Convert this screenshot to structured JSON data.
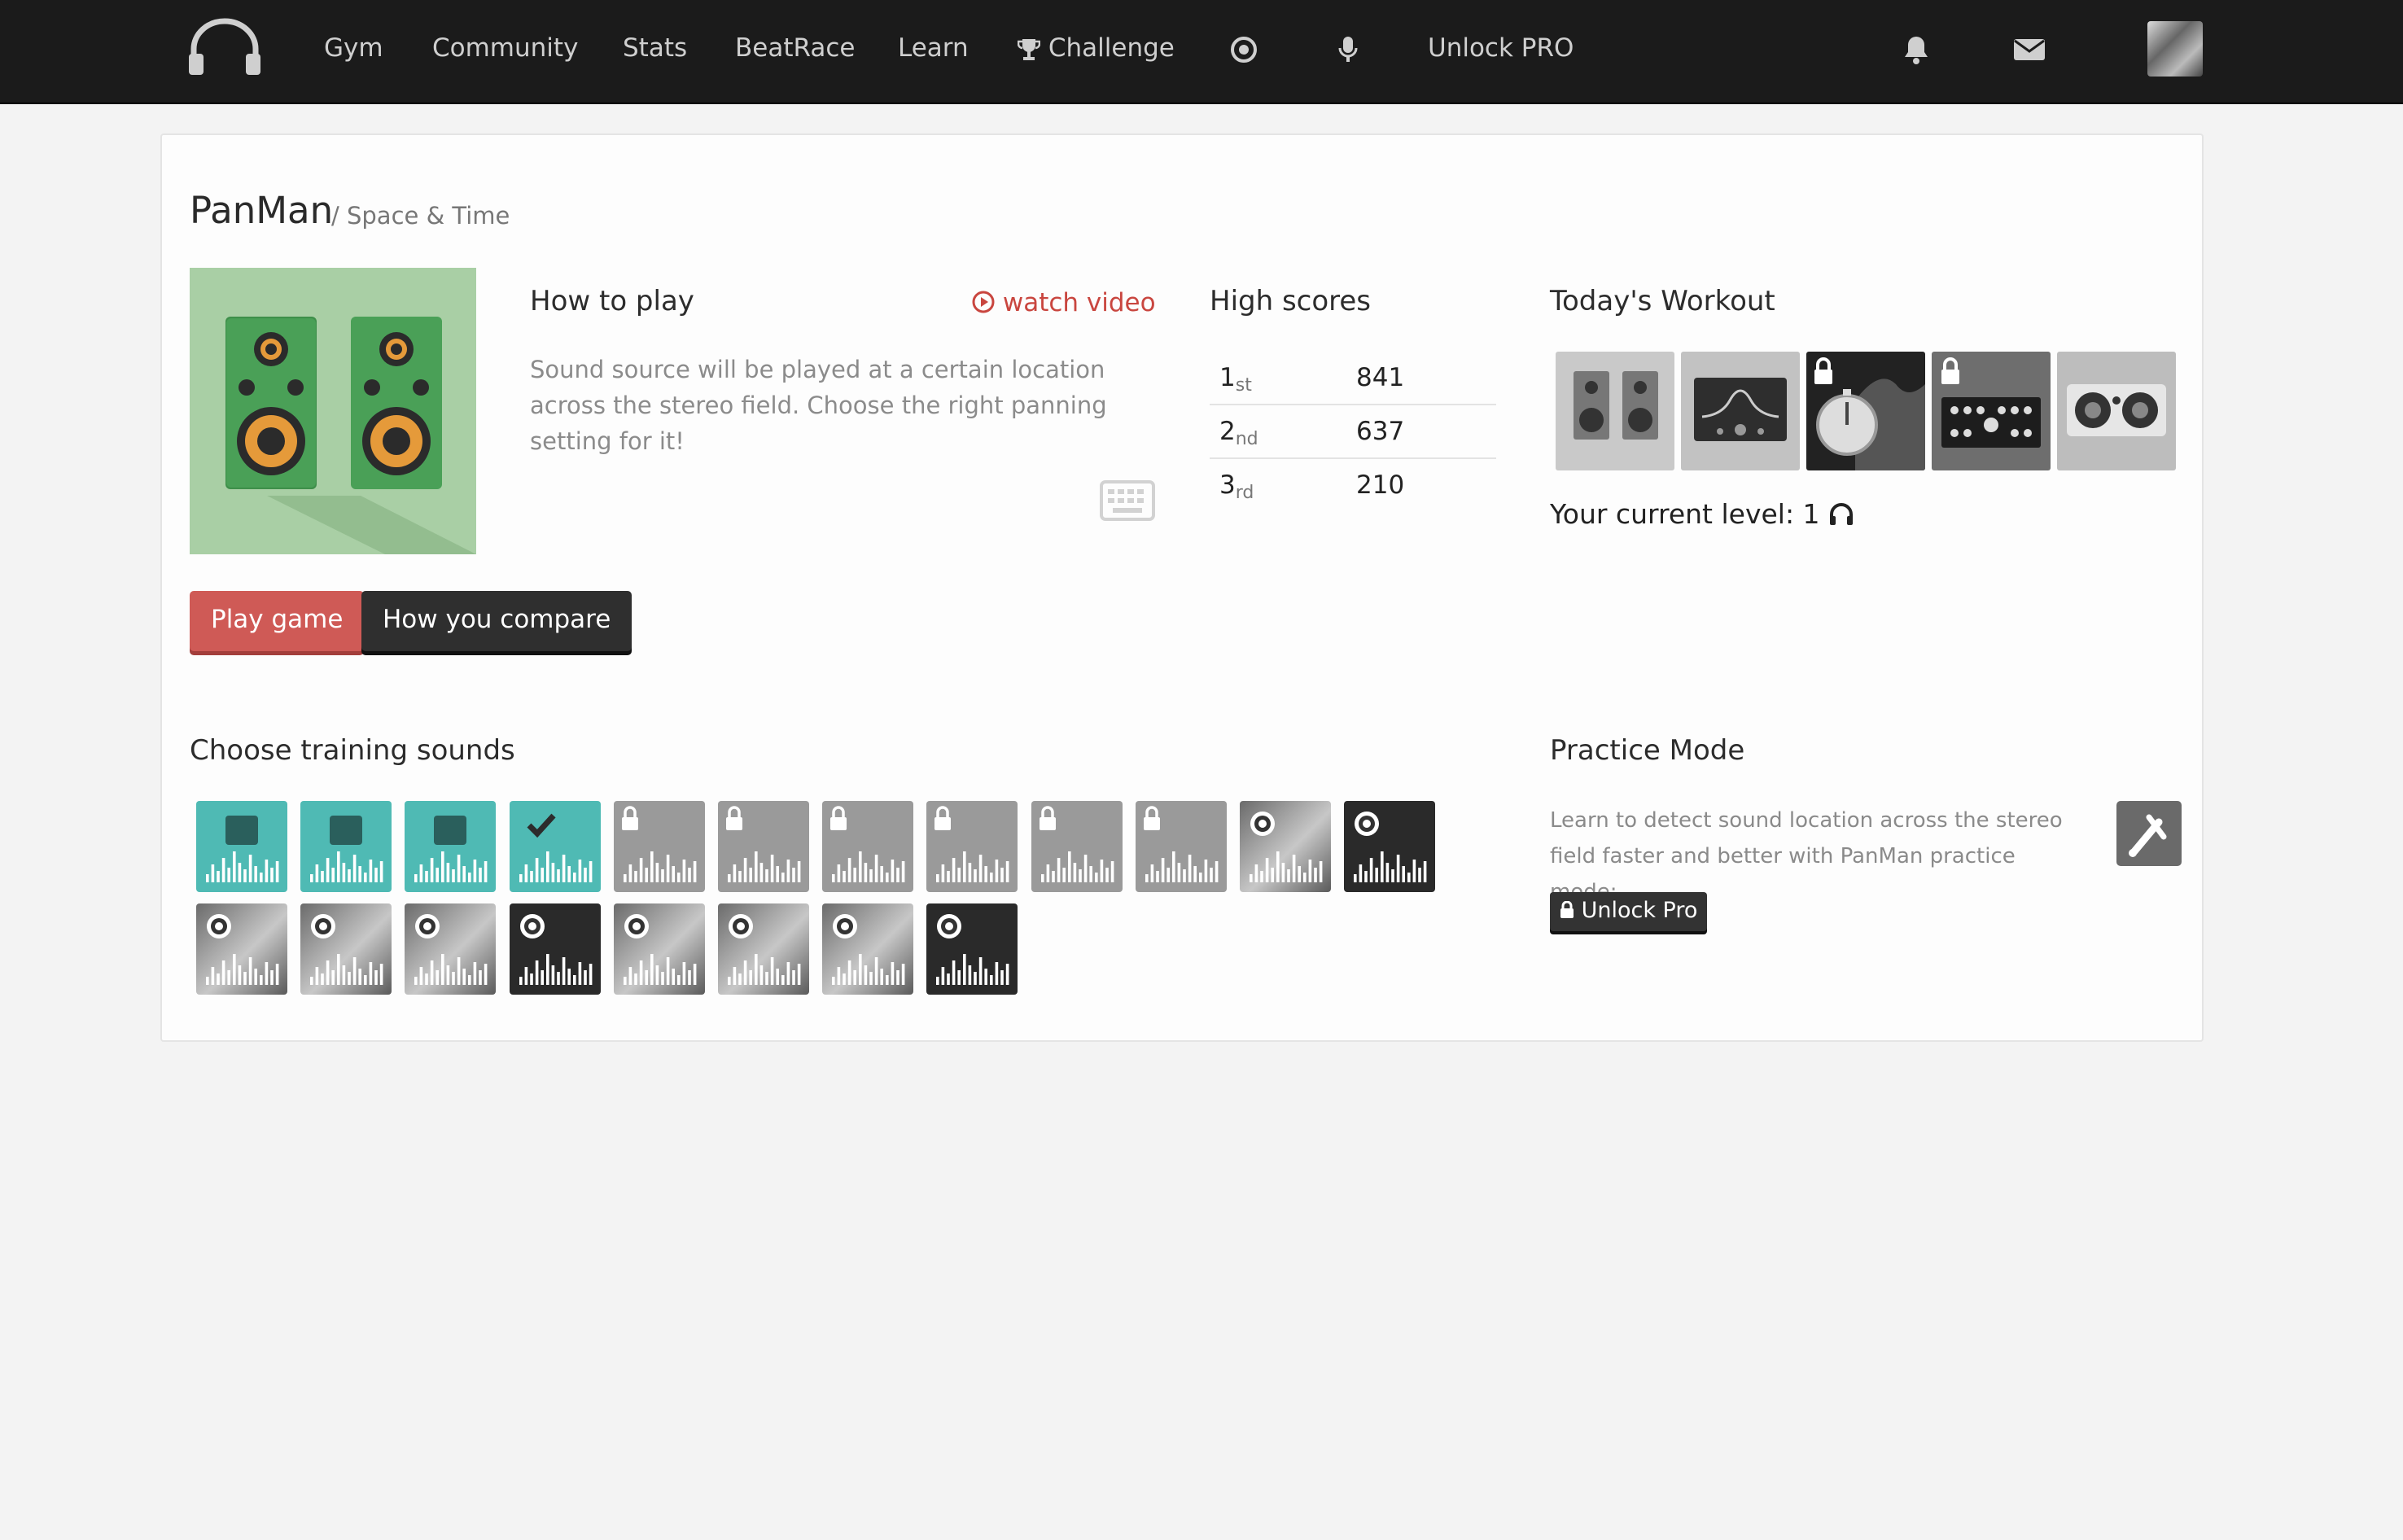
{
  "nav": {
    "items": [
      "Gym",
      "Community",
      "Stats",
      "BeatRace",
      "Learn",
      "Challenge",
      "Unlock PRO"
    ],
    "icons": [
      "headphones-logo-icon",
      "trophy-icon",
      "target-icon",
      "microphone-icon",
      "bell-icon",
      "envelope-icon",
      "avatar"
    ]
  },
  "game": {
    "title": "PanMan",
    "subtitle": "/ Space & Time",
    "how_to_play": "How to play",
    "watch_video": "watch video",
    "description": "Sound source will be played at a certain location across the stereo field. Choose the right panning setting for it!",
    "play_button": "Play game",
    "compare_button": "How you compare"
  },
  "high_scores": {
    "title": "High scores",
    "rows": [
      {
        "rank": "1",
        "suffix": "st",
        "score": "841"
      },
      {
        "rank": "2",
        "suffix": "nd",
        "score": "637"
      },
      {
        "rank": "3",
        "suffix": "rd",
        "score": "210"
      }
    ]
  },
  "workout": {
    "title": "Today's Workout",
    "level_label": "Your current level: 1",
    "tiles": [
      "speakers",
      "equalizer",
      "stopwatch-locked",
      "mixer-locked",
      "stereo"
    ]
  },
  "training": {
    "title": "Choose training sounds",
    "row1": [
      "drum-machine",
      "electric-guitar",
      "acoustic-guitar",
      "piano-selected",
      "vocals-locked",
      "violin-locked",
      "trumpet-locked",
      "synth-locked",
      "percussion-locked",
      "drums-locked",
      "photo-voice",
      "drum-loop"
    ],
    "row2": [
      "photo-woman",
      "photo-subway",
      "photo-band",
      "photo-concert",
      "photo-dog",
      "photo-singer",
      "photo-studio",
      "drum-machine-playlist"
    ]
  },
  "practice": {
    "title": "Practice Mode",
    "description": "Learn to detect sound location across the stereo field faster and better with PanMan practice mode:",
    "unlock": "Unlock Pro"
  },
  "colors": {
    "accent_red": "#cf5a56",
    "teal": "#4fbab4",
    "topbar": "#1b1b1b"
  }
}
